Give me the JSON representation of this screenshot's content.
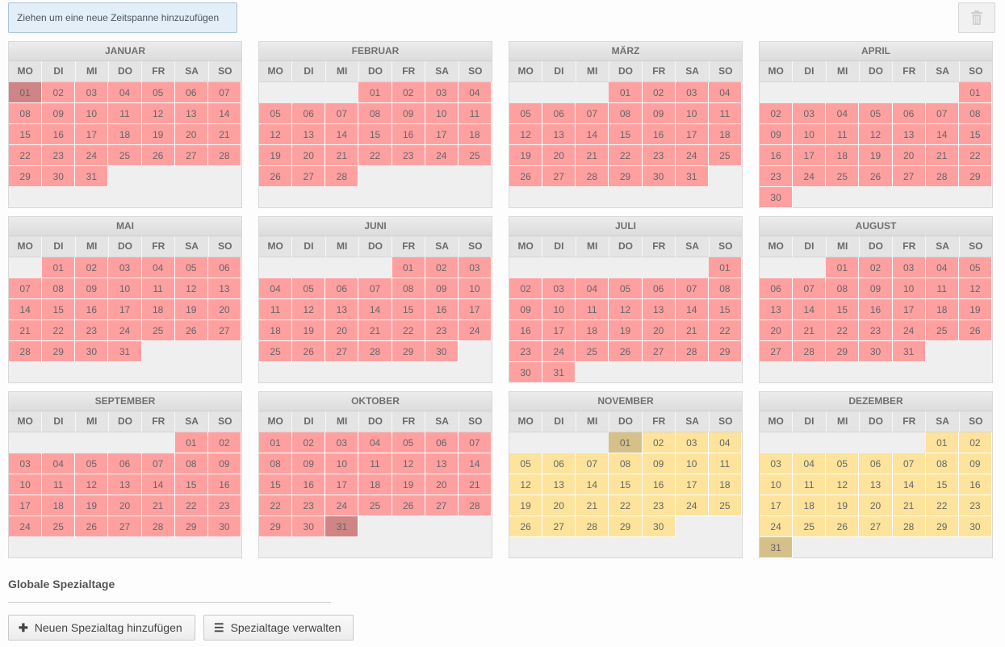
{
  "toolbar": {
    "hint": "Ziehen um eine neue Zeitspanne hinzuzufügen",
    "delete_icon": "trash-icon"
  },
  "weekdays": [
    "MO",
    "DI",
    "MI",
    "DO",
    "FR",
    "SA",
    "SO"
  ],
  "months": [
    {
      "name": "JANUAR",
      "offset": 0,
      "days": 31,
      "color": "red",
      "selected": [
        1
      ]
    },
    {
      "name": "FEBRUAR",
      "offset": 3,
      "days": 28,
      "color": "red",
      "selected": []
    },
    {
      "name": "MÄRZ",
      "offset": 3,
      "days": 31,
      "color": "red",
      "selected": []
    },
    {
      "name": "APRIL",
      "offset": 6,
      "days": 30,
      "color": "red",
      "selected": []
    },
    {
      "name": "MAI",
      "offset": 1,
      "days": 31,
      "color": "red",
      "selected": []
    },
    {
      "name": "JUNI",
      "offset": 4,
      "days": 30,
      "color": "red",
      "selected": []
    },
    {
      "name": "JULI",
      "offset": 6,
      "days": 31,
      "color": "red",
      "selected": []
    },
    {
      "name": "AUGUST",
      "offset": 2,
      "days": 31,
      "color": "red",
      "selected": []
    },
    {
      "name": "SEPTEMBER",
      "offset": 5,
      "days": 30,
      "color": "red",
      "selected": []
    },
    {
      "name": "OKTOBER",
      "offset": 0,
      "days": 31,
      "color": "red",
      "selected": [
        31
      ]
    },
    {
      "name": "NOVEMBER",
      "offset": 3,
      "days": 30,
      "color": "yellow",
      "selected": [
        1
      ]
    },
    {
      "name": "DEZEMBER",
      "offset": 5,
      "days": 31,
      "color": "yellow",
      "selected": [
        31
      ]
    }
  ],
  "colors": {
    "red": "#ffa0a0",
    "red_selected": "#cf8585",
    "yellow": "#fde39b",
    "yellow_selected": "#d5c089"
  },
  "global": {
    "title": "Globale Spezialtage",
    "add_label": "Neuen Spezialtag hinzufügen",
    "add_icon": "plus-icon",
    "manage_label": "Spezialtage verwalten",
    "manage_icon": "list-icon"
  }
}
